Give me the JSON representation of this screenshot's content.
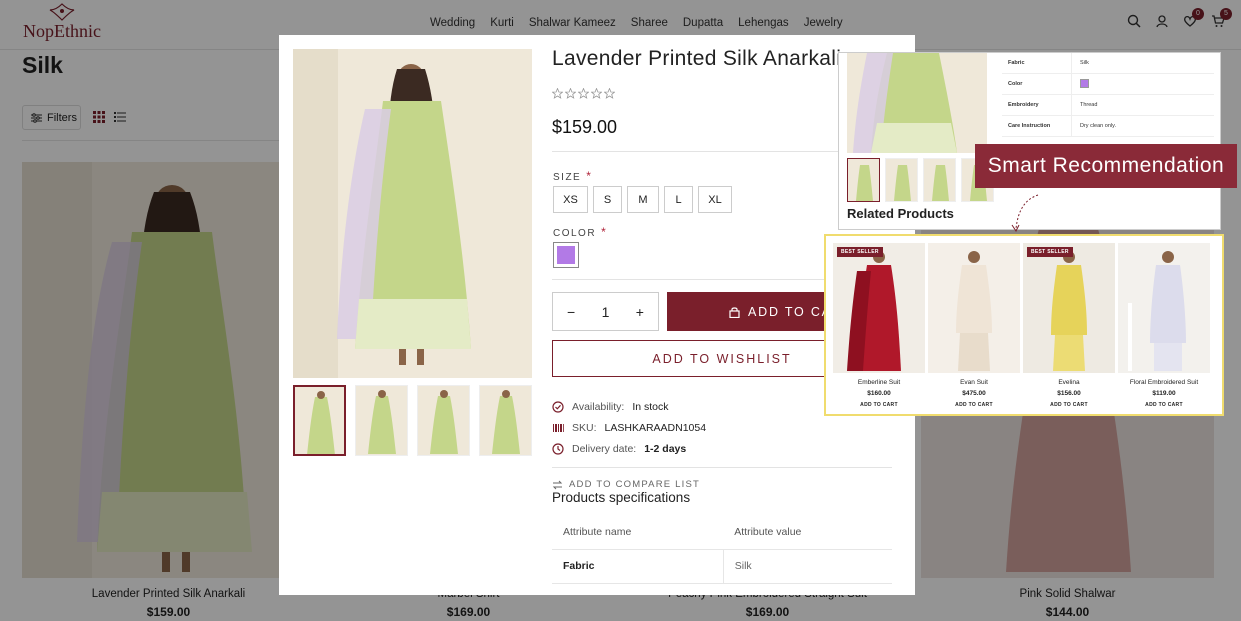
{
  "header": {
    "logo_text": "NopEthnic",
    "nav": [
      "Wedding",
      "Kurti",
      "Shalwar Kameez",
      "Sharee",
      "Dupatta",
      "Lehengas",
      "Jewelry"
    ],
    "wishlist_count": "0",
    "cart_count": "5"
  },
  "page": {
    "title": "Silk",
    "filters_label": "Filters"
  },
  "grid": [
    {
      "name": "Lavender Printed Silk Anarkali",
      "price": "$159.00"
    },
    {
      "name": "Marbel Shirt",
      "price": "$169.00"
    },
    {
      "name": "Peachy Pink Embroidered Straight Suit",
      "price": "$169.00"
    },
    {
      "name": "Pink Solid Shalwar",
      "price": "$144.00"
    }
  ],
  "product": {
    "title": "Lavender Printed Silk Anarkali",
    "price": "$159.00",
    "rating_stars": 0,
    "size_label": "SIZE",
    "sizes": [
      "XS",
      "S",
      "M",
      "L",
      "XL"
    ],
    "color_label": "COLOR",
    "color_hex": "#b27ae6",
    "quantity": "1",
    "add_to_cart": "ADD TO CART",
    "add_to_wishlist": "ADD TO WISHLIST",
    "availability_label": "Availability:",
    "availability_value": "In stock",
    "sku_label": "SKU:",
    "sku_value": "LASHKARAADN1054",
    "delivery_label": "Delivery date:",
    "delivery_value": "1-2 days",
    "compare_label": "ADD TO COMPARE LIST",
    "spec_title": "Products specifications",
    "spec_headers": [
      "Attribute name",
      "Attribute value"
    ],
    "spec_rows": [
      {
        "name": "Fabric",
        "value": "Silk"
      }
    ]
  },
  "callout": {
    "spec_rows": [
      {
        "name": "Fabric",
        "value": "Silk"
      },
      {
        "name": "Color",
        "value": ""
      },
      {
        "name": "Embroidery",
        "value": "Thread"
      },
      {
        "name": "Care Instruction",
        "value": "Dry clean only."
      }
    ],
    "related_title": "Related Products",
    "badge": "Smart Recommendation",
    "best_seller": "BEST SELLER",
    "add_to_cart": "ADD TO CART",
    "products": [
      {
        "name": "Emberline Suit",
        "price": "$160.00",
        "best_seller": true
      },
      {
        "name": "Evan Suit",
        "price": "$475.00",
        "best_seller": false
      },
      {
        "name": "Evelina",
        "price": "$156.00",
        "best_seller": true
      },
      {
        "name": "Floral Embroidered Suit",
        "price": "$119.00",
        "best_seller": false
      }
    ]
  },
  "colors": {
    "brand": "#7a1f2b",
    "accent_yellow": "#f0dc6e",
    "dress_green": "#c4d68a",
    "swatch_purple": "#b27ae6"
  }
}
